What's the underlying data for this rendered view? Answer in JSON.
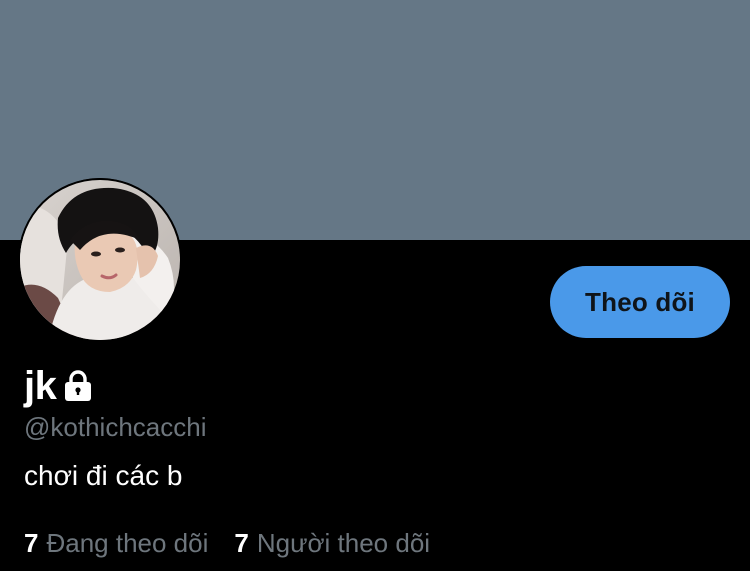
{
  "profile": {
    "display_name": "jk",
    "handle": "@kothichcacchi",
    "bio": "chơi đi các b",
    "locked": true
  },
  "actions": {
    "follow_label": "Theo dõi"
  },
  "stats": {
    "following_count": "7",
    "following_label": "Đang theo dõi",
    "followers_count": "7",
    "followers_label": "Người theo dõi"
  },
  "icons": {
    "lock": "lock-icon",
    "avatar": "avatar-photo"
  },
  "colors": {
    "banner": "#657786",
    "background": "#000000",
    "accent": "#4a99e9",
    "muted_text": "#6e767d",
    "text": "#ffffff"
  }
}
